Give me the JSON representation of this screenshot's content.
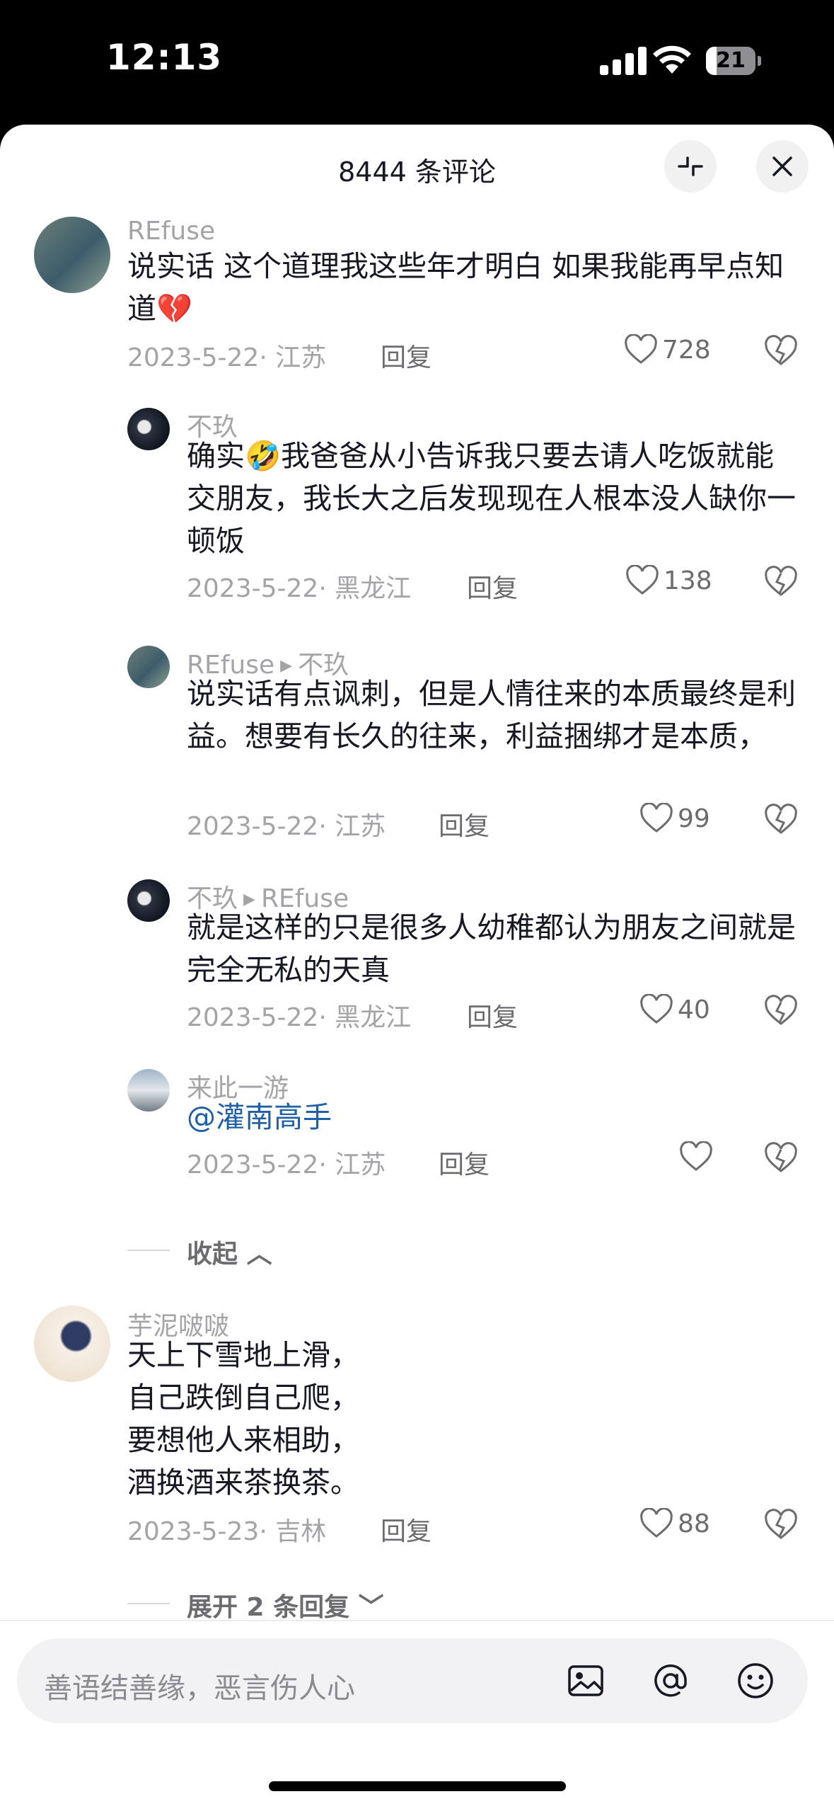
{
  "status": {
    "time": "12:13",
    "battery": "21",
    "battery_level": 0.21
  },
  "header": {
    "title": "8444 条评论",
    "minimize_icon": "minimize-icon",
    "close_icon": "close-icon"
  },
  "comments": [
    {
      "user": "REfuse",
      "text": "说实话 这个道理我这些年才明白 如果我能再早点知道",
      "emoji": "💔",
      "date": "2023-5-22",
      "location": "江苏",
      "reply_label": "回复",
      "likes": "728",
      "replies": [
        {
          "user": "不玖",
          "text_pre": "确实",
          "emoji": "🤣",
          "text": "我爸爸从小告诉我只要去请人吃饭就能交朋友，我长大之后发现现在人根本没人缺你一顿饭",
          "date": "2023-5-22",
          "location": "黑龙江",
          "reply_label": "回复",
          "likes": "138"
        },
        {
          "user": "REfuse",
          "to": "不玖",
          "text": "说实话有点讽刺，但是人情往来的本质最终是利益。想要有长久的往来，利益捆绑才是本质，",
          "date": "2023-5-22",
          "location": "江苏",
          "reply_label": "回复",
          "likes": "99"
        },
        {
          "user": "不玖",
          "to": "REfuse",
          "text": "就是这样的只是很多人幼稚都认为朋友之间就是完全无私的天真",
          "date": "2023-5-22",
          "location": "黑龙江",
          "reply_label": "回复",
          "likes": "40"
        },
        {
          "user": "来此一游",
          "text": "@灌南高手",
          "date": "2023-5-22",
          "location": "江苏",
          "reply_label": "回复",
          "likes": ""
        }
      ],
      "collapse_label": "收起"
    },
    {
      "user": "芋泥啵啵",
      "lines": [
        "天上下雪地上滑，",
        "自己跌倒自己爬，",
        "要想他人来相助，",
        "酒换酒来茶换茶。"
      ],
      "date": "2023-5-23",
      "location": "吉林",
      "reply_label": "回复",
      "likes": "88",
      "expand_label": "展开 2 条回复"
    }
  ],
  "composer": {
    "placeholder": "善语结善缘，恶言伤人心",
    "icons": [
      "image-icon",
      "at-icon",
      "emoji-icon"
    ]
  }
}
